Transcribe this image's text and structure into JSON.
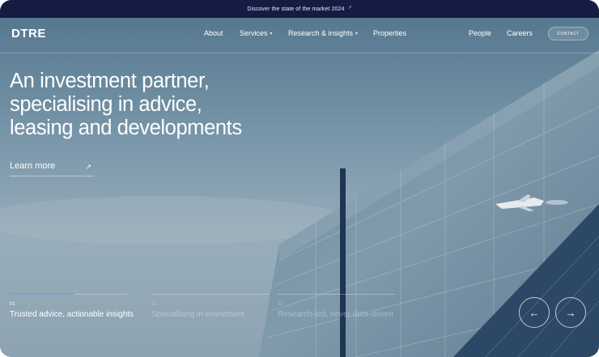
{
  "announcement": {
    "text": "Discover the state of the market 2024",
    "icon": "external-link-icon"
  },
  "brand": {
    "logo": "DTRE"
  },
  "nav": {
    "about": "About",
    "services": "Services",
    "research": "Research & insights",
    "properties": "Properties",
    "people": "People",
    "careers": "Careers",
    "contact": "CONTACT"
  },
  "hero": {
    "headline": [
      "An investment partner,",
      "specialising in advice,",
      "leasing and developments"
    ],
    "cta": "Learn more",
    "cta_icon": "arrow-up-right-icon"
  },
  "slides": [
    {
      "num": "01",
      "label": "Trusted advice, actionable insights",
      "active": true,
      "progress": 0.55
    },
    {
      "num": "02",
      "label": "Specialising in investment",
      "active": false,
      "progress": 0
    },
    {
      "num": "03",
      "label": "Research-led, never data-driven",
      "active": false,
      "progress": 0
    }
  ],
  "carousel": {
    "prev_icon": "arrow-left-icon",
    "next_icon": "arrow-right-icon"
  },
  "colors": {
    "announce_bg": "#141c44",
    "accent": "#7aa6c8"
  }
}
